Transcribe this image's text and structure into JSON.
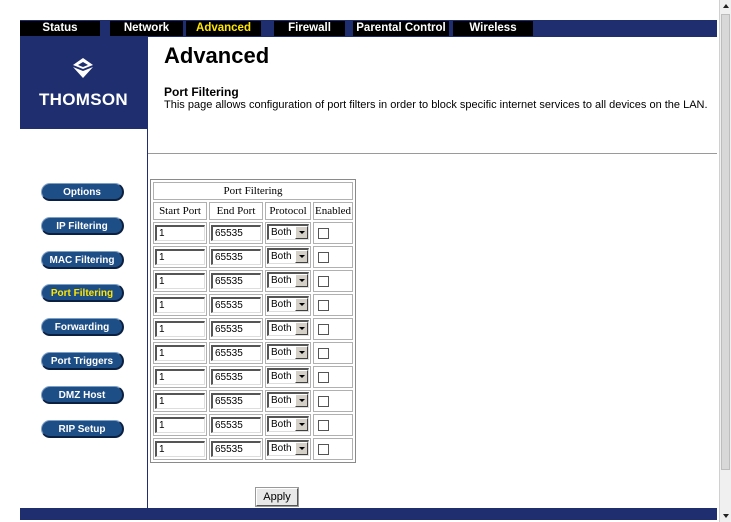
{
  "tabs": [
    {
      "label": "Status",
      "active": false
    },
    {
      "label": "Network",
      "active": false
    },
    {
      "label": "Advanced",
      "active": true
    },
    {
      "label": "Firewall",
      "active": false
    },
    {
      "label": "Parental Control",
      "active": false
    },
    {
      "label": "Wireless",
      "active": false
    }
  ],
  "brand": {
    "name": "THOMSON",
    "logo_icon": "thomson-logo-icon"
  },
  "sidebar": {
    "items": [
      {
        "label": "Options",
        "active": false
      },
      {
        "label": "IP Filtering",
        "active": false
      },
      {
        "label": "MAC Filtering",
        "active": false
      },
      {
        "label": "Port Filtering",
        "active": true
      },
      {
        "label": "Forwarding",
        "active": false
      },
      {
        "label": "Port Triggers",
        "active": false
      },
      {
        "label": "DMZ Host",
        "active": false
      },
      {
        "label": "RIP Setup",
        "active": false
      }
    ]
  },
  "page": {
    "title": "Advanced",
    "section": "Port Filtering",
    "description": "This page allows configuration of port filters in order to block specific internet services to all devices on the LAN."
  },
  "port_table": {
    "title": "Port Filtering",
    "headers": [
      "Start Port",
      "End Port",
      "Protocol",
      "Enabled"
    ],
    "rows": [
      {
        "start": "1",
        "end": "65535",
        "protocol": "Both",
        "enabled": false
      },
      {
        "start": "1",
        "end": "65535",
        "protocol": "Both",
        "enabled": false
      },
      {
        "start": "1",
        "end": "65535",
        "protocol": "Both",
        "enabled": false
      },
      {
        "start": "1",
        "end": "65535",
        "protocol": "Both",
        "enabled": false
      },
      {
        "start": "1",
        "end": "65535",
        "protocol": "Both",
        "enabled": false
      },
      {
        "start": "1",
        "end": "65535",
        "protocol": "Both",
        "enabled": false
      },
      {
        "start": "1",
        "end": "65535",
        "protocol": "Both",
        "enabled": false
      },
      {
        "start": "1",
        "end": "65535",
        "protocol": "Both",
        "enabled": false
      },
      {
        "start": "1",
        "end": "65535",
        "protocol": "Both",
        "enabled": false
      },
      {
        "start": "1",
        "end": "65535",
        "protocol": "Both",
        "enabled": false
      }
    ]
  },
  "apply_label": "Apply",
  "colors": {
    "navy": "#1e2e6e",
    "button_blue": "#1e4e86",
    "active_text": "#ffe600"
  }
}
